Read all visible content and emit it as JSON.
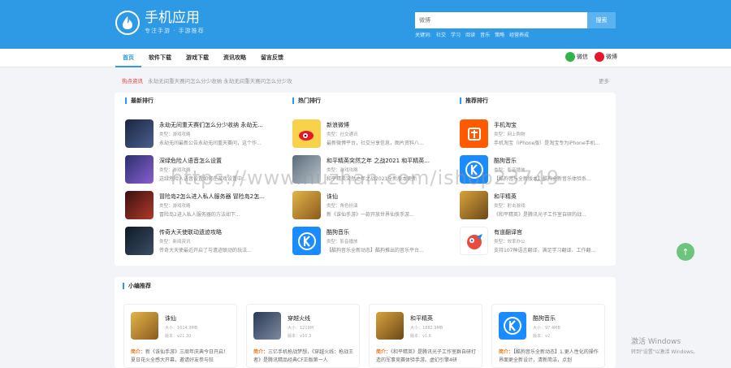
{
  "colors": {
    "brand": "#2e9ae6",
    "hot": "#e53935",
    "intro": "#e67e22"
  },
  "header": {
    "logo_title": "手机应用",
    "logo_sub": "专注手游 · 手游推荐",
    "search_placeholder": "微博",
    "search_button": "搜索",
    "keyword_label": "关键词:",
    "keywords": [
      "社交",
      "学习",
      "阅读",
      "音乐",
      "策略",
      "经营养成"
    ]
  },
  "nav": {
    "items": [
      "首页",
      "软件下载",
      "游戏下载",
      "资讯攻略",
      "留言反馈"
    ],
    "share_wechat": "微信",
    "share_weibo": "微博"
  },
  "hot": {
    "tag": "热点资讯",
    "text": "永劫无间重天赛问怎么分少收纳 永劫无间重天赛问怎么分少攻",
    "more": "更多"
  },
  "rankings": {
    "latest": {
      "title": "最新排行",
      "items": [
        {
          "title": "永劫无间重天赛们怎么分少收纳 永劫无...",
          "meta": "类型：游戏攻略",
          "desc": "永劫无间最新公告永劫无间重天赛问，这个作..."
        },
        {
          "title": "深绿危险人语音怎么设置",
          "meta": "类型：游戏攻略",
          "desc": "这绿危险人语音设置如何在游戏设置中..."
        },
        {
          "title": "冒险岛2怎么进入私人服务器 冒险岛2怎...",
          "meta": "类型：游戏攻略",
          "desc": "冒险岛2进入私人服务器的方法如下..."
        },
        {
          "title": "传奇大天使联动遗迹攻略",
          "meta": "类型：新闻资讯",
          "desc": "传奇大天使最近开启了与遗迹联动的玩法..."
        }
      ]
    },
    "hot": {
      "title": "热门排行",
      "items": [
        {
          "title": "新浪微博",
          "meta": "类型：社交通讯",
          "desc": "最新微博平台，社交分享信息，图片资料八..."
        },
        {
          "title": "和平精英突然之年 之战2021 和平精英...",
          "meta": "类型：游戏攻略",
          "desc": "和平精英突然之年之战2021全新版本更新"
        },
        {
          "title": "诛仙",
          "meta": "类型：角色扮演",
          "desc": "新《诛仙手游》一款开放世界仙侠手游..."
        },
        {
          "title": "酷狗音乐",
          "meta": "类型：影音播放",
          "desc": "【酷狗音乐全新动态】酷狗推出的音乐平台..."
        }
      ]
    },
    "recommend": {
      "title": "推荐排行",
      "items": [
        {
          "title": "手机淘宝",
          "meta": "类型：网上购物",
          "desc": "手机淘宝（iPhone版）是淘宝专为iPhone手机..."
        },
        {
          "title": "酷狗音乐",
          "meta": "类型：影音播放",
          "desc": "【酷狗音乐全新版本】酷狗全新音乐体验系..."
        },
        {
          "title": "和平精英",
          "meta": "类型：射击游戏",
          "desc": "《和平精英》是腾讯光子工作室自研的战..."
        },
        {
          "title": "有道翻译官",
          "meta": "类型：效率办公",
          "desc": "支持107种语言翻译，满足学习翻译、工作翻..."
        }
      ]
    }
  },
  "editor": {
    "title": "小编推荐",
    "cards": [
      {
        "name": "诛仙",
        "size": "大小：1614.9MB",
        "version": "版本：v21.30",
        "intro_label": "简介：",
        "intro": "新《诛仙手游》三周年庆典今日开启！夏日花火全感大开幕，邀请好友参与狂"
      },
      {
        "name": "穿越火线",
        "size": "大小：1219M",
        "version": "版本：v10.3",
        "intro_label": "简介：",
        "intro": "三亿手机枪战梦想，《穿越火线：枪战王者》是腾讯精品经典CF正版第一人"
      },
      {
        "name": "和平精英",
        "size": "大小：1882.9MB",
        "version": "版本：v1.6",
        "intro_label": "简介：",
        "intro": "《和平精英》是腾讯光子工作室群自研打造的军事竞赛体验手游。虚幻引擎4研"
      },
      {
        "name": "酷狗音乐",
        "size": "大小：97.4MB",
        "version": "版本：v2",
        "intro_label": "简介：",
        "intro": "【酷狗音乐全新动态】1.更人性化的操作界面更全新设计，清新简洁，点划"
      }
    ]
  },
  "overlay": {
    "watermark": "https://www.huzhan.com/ishop23749",
    "activate_line1": "激活 Windows",
    "activate_line2": "转到\"设置\"以激活 Windows。"
  },
  "fab_label": "↑"
}
